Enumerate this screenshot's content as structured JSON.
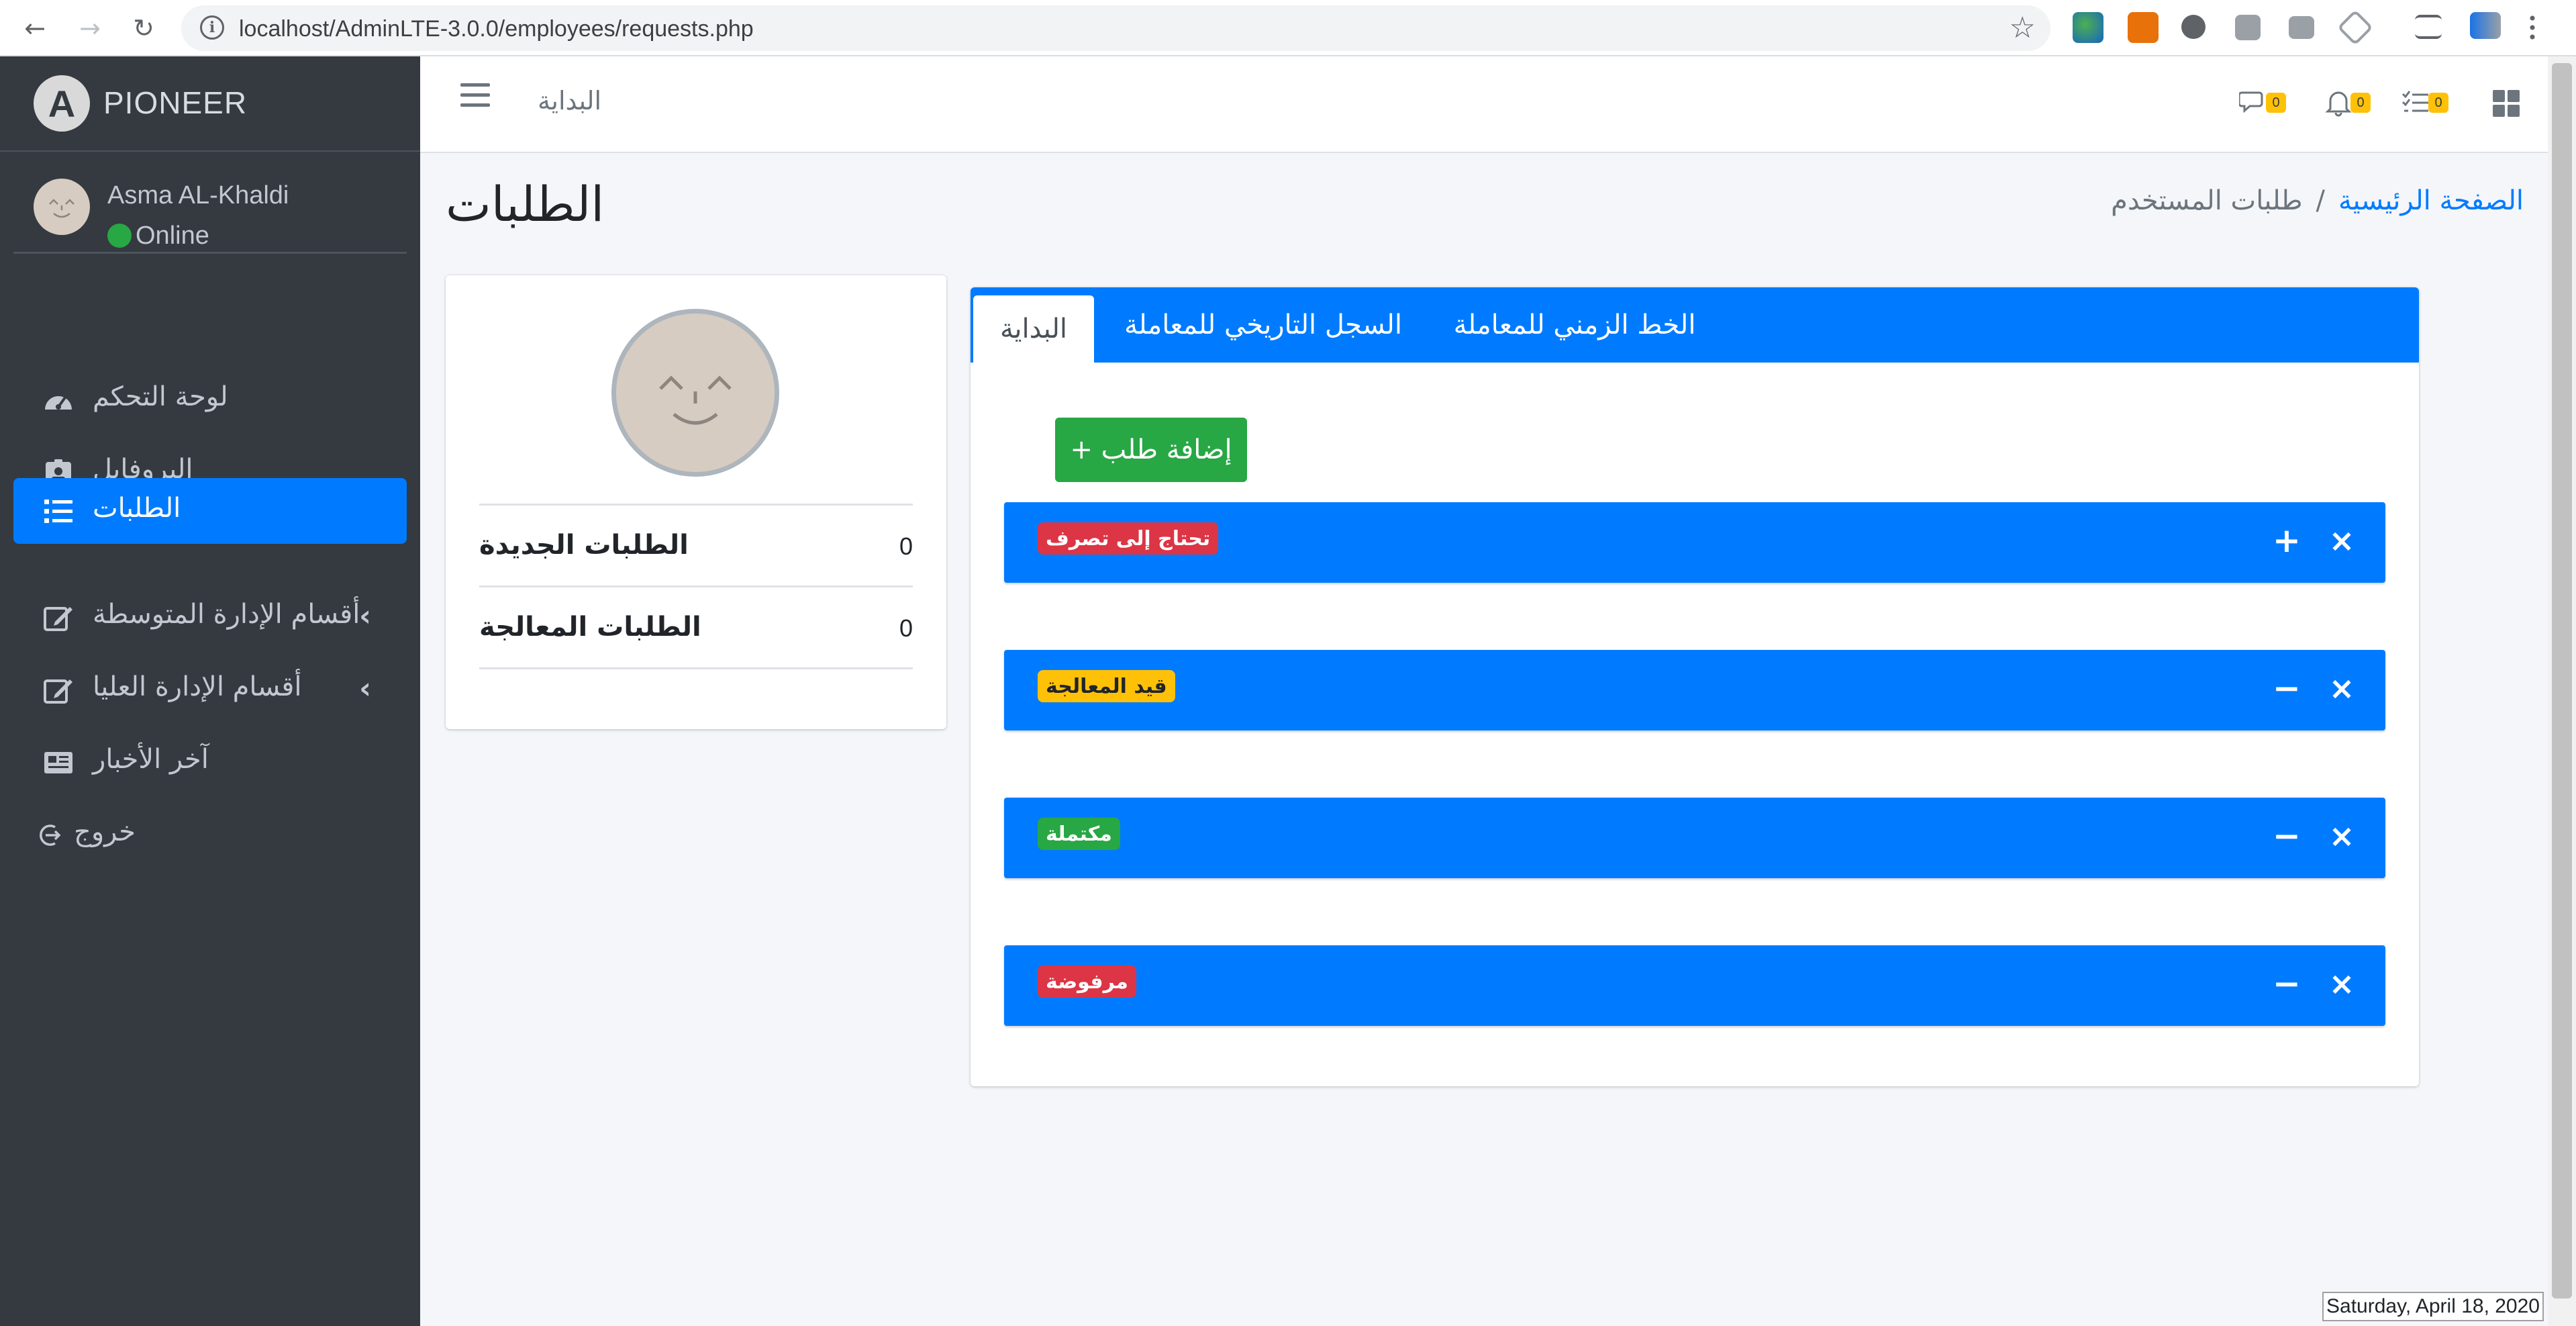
{
  "browser": {
    "url": "localhost/AdminLTE-3.0.0/employees/requests.php",
    "back_icon": "arrow-left-icon",
    "forward_icon": "arrow-right-icon",
    "reload_icon": "reload-icon"
  },
  "brand": {
    "name": "PIONEER",
    "logo_letter": "A"
  },
  "user": {
    "name": "Asma AL-Khaldi",
    "status": "Online"
  },
  "sidebar": {
    "items": [
      {
        "label": "لوحة التحكم",
        "icon": "tachometer-icon"
      },
      {
        "label": "البروفايل",
        "icon": "id-badge-icon"
      },
      {
        "label": "الطلبات",
        "icon": "list-icon",
        "active": true
      },
      {
        "label": "أقسام الإدارة المتوسطة",
        "icon": "edit-icon",
        "has_arrow": true
      },
      {
        "label": "أقسام الإدارة العليا",
        "icon": "edit-icon",
        "has_arrow": true
      },
      {
        "label": "آخر الأخبار",
        "icon": "newspaper-icon"
      },
      {
        "label": "خروج",
        "icon": "sign-out-icon"
      }
    ],
    "arrow": "‹"
  },
  "topnav": {
    "home_link": "البداية",
    "messages_count": "0",
    "notifications_count": "0",
    "tasks_count": "0"
  },
  "page": {
    "title": "الطلبات",
    "breadcrumb": {
      "home": "الصفحة الرئيسية",
      "separator": "/",
      "current": "طلبات المستخدم"
    }
  },
  "profile_card": {
    "stats": [
      {
        "label": "الطلبات الجديدة",
        "value": "0"
      },
      {
        "label": "الطلبات المعالجة",
        "value": "0"
      }
    ]
  },
  "tabs": {
    "items": [
      {
        "label": "البداية",
        "active": true
      },
      {
        "label": "السجل التاريخي للمعاملة"
      },
      {
        "label": "الخط الزمني للمعاملة"
      }
    ],
    "add_button": "إضافة طلب +"
  },
  "requests": [
    {
      "badge": "تحتاج إلى تصرف",
      "badge_color": "#dc3545",
      "badge_text_color": "#ffffff",
      "toggle": "+",
      "close": "×"
    },
    {
      "badge": "قيد المعالجة",
      "badge_color": "#ffc107",
      "badge_text_color": "#212529",
      "toggle": "−",
      "close": "×"
    },
    {
      "badge": "مكتملة",
      "badge_color": "#28a745",
      "badge_text_color": "#ffffff",
      "toggle": "−",
      "close": "×"
    },
    {
      "badge": "مرفوضة",
      "badge_color": "#dc3545",
      "badge_text_color": "#ffffff",
      "toggle": "−",
      "close": "×"
    }
  ],
  "taskbar": {
    "date": "Saturday, April 18, 2020"
  },
  "colors": {
    "primary": "#007bff",
    "success": "#28a745",
    "danger": "#dc3545",
    "warning": "#ffc107",
    "sidebar": "#343a40"
  }
}
